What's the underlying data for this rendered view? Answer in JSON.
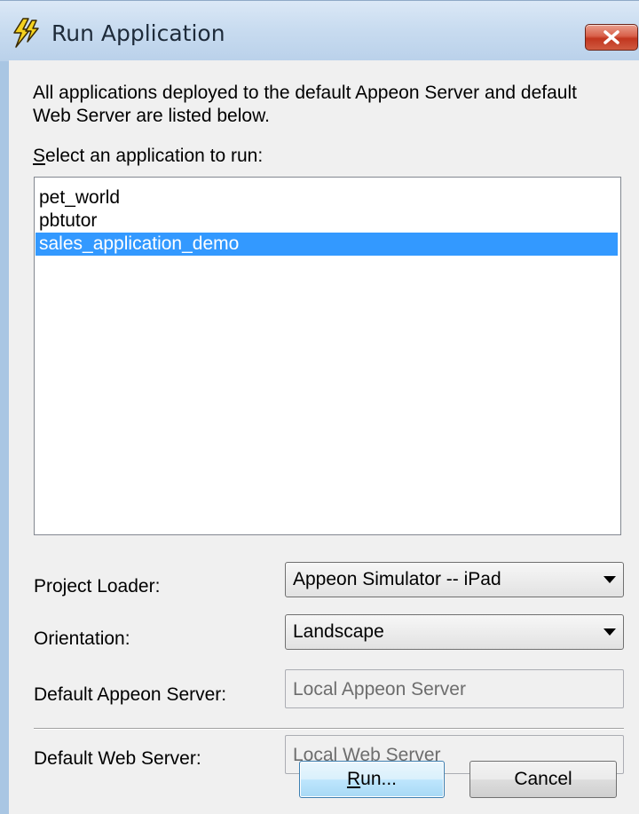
{
  "window": {
    "title": "Run Application",
    "icon": "lightning-bolt-icon",
    "close_icon": "close-icon"
  },
  "intro_text": "All applications deployed to the default Appeon Server and default Web Server are listed below.",
  "select_label": {
    "accel": "S",
    "rest": "elect an application to run:"
  },
  "applications": [
    {
      "label": "pet_world",
      "selected": false
    },
    {
      "label": "pbtutor",
      "selected": false
    },
    {
      "label": "sales_application_demo",
      "selected": true
    }
  ],
  "fields": {
    "project_loader": {
      "label": "Project Loader:",
      "value": "Appeon Simulator -- iPad"
    },
    "orientation": {
      "label": "Orientation:",
      "value": "Landscape"
    },
    "default_appeon_server": {
      "label": "Default Appeon Server:",
      "value": "Local Appeon Server"
    },
    "default_web_server": {
      "label": "Default Web Server:",
      "value": "Local Web Server"
    }
  },
  "buttons": {
    "run": {
      "accel": "R",
      "rest": "un..."
    },
    "cancel": "Cancel"
  },
  "colors": {
    "selection": "#3399ff",
    "dialog_bg": "#f0f0f0",
    "close_button": "#c2361f"
  }
}
